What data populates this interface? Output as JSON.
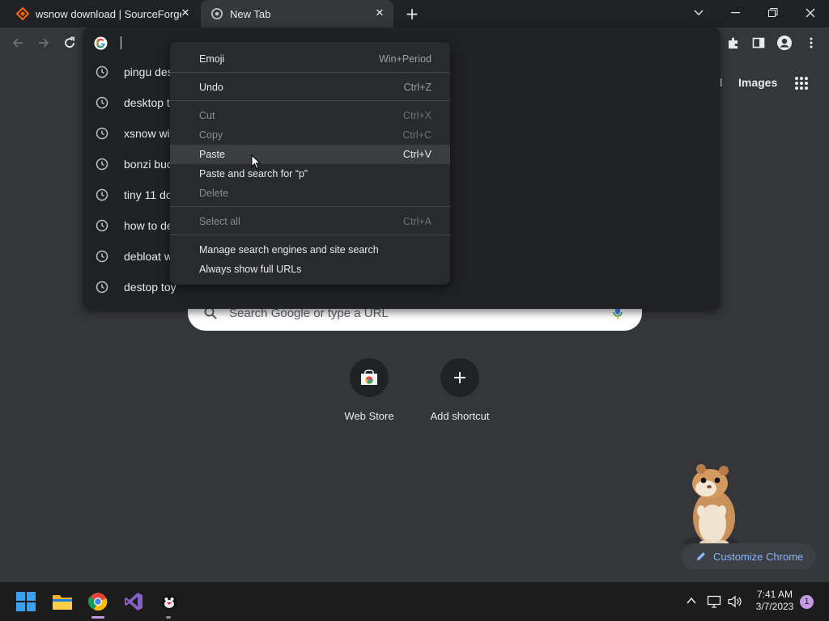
{
  "tabs": [
    {
      "title": "wsnow download | SourceForge.net",
      "active": false,
      "favicon": "sourceforge-icon"
    },
    {
      "title": "New Tab",
      "active": true,
      "favicon": "chrome-icon"
    }
  ],
  "omnibox": {
    "value": "",
    "suggestions": [
      "pingu des",
      "desktop t",
      "xsnow wi",
      "bonzi buc",
      "tiny 11 do",
      "how to de",
      "debloat w",
      "destop toy"
    ]
  },
  "context_menu": {
    "items": [
      {
        "label": "Emoji",
        "shortcut": "Win+Period",
        "enabled": true
      },
      {
        "label": "Undo",
        "shortcut": "Ctrl+Z",
        "enabled": true
      },
      {
        "label": "Cut",
        "shortcut": "Ctrl+X",
        "enabled": false
      },
      {
        "label": "Copy",
        "shortcut": "Ctrl+C",
        "enabled": false
      },
      {
        "label": "Paste",
        "shortcut": "Ctrl+V",
        "enabled": true,
        "highlighted": true
      },
      {
        "label": "Paste and search for “p”",
        "shortcut": "",
        "enabled": true
      },
      {
        "label": "Delete",
        "shortcut": "",
        "enabled": false
      },
      {
        "label": "Select all",
        "shortcut": "Ctrl+A",
        "enabled": false
      },
      {
        "label": "Manage search engines and site search",
        "shortcut": "",
        "enabled": true
      },
      {
        "label": "Always show full URLs",
        "shortcut": "",
        "enabled": true
      }
    ]
  },
  "ntp": {
    "header_links": {
      "gmail_partial": "il",
      "images": "Images"
    },
    "search_placeholder": "Search Google or type a URL",
    "shortcuts": [
      {
        "label": "Web Store",
        "icon": "web-store-icon"
      },
      {
        "label": "Add shortcut",
        "icon": "plus-icon"
      }
    ],
    "customize_label": "Customize Chrome"
  },
  "taskbar": {
    "time": "7:41 AM",
    "date": "3/7/2023",
    "notification_count": "1"
  },
  "colors": {
    "background": "#35363a",
    "frame": "#202124",
    "accent_link": "#8ab4f8",
    "menu_bg": "#292a2d",
    "taskbar": "#1c1c1c"
  }
}
